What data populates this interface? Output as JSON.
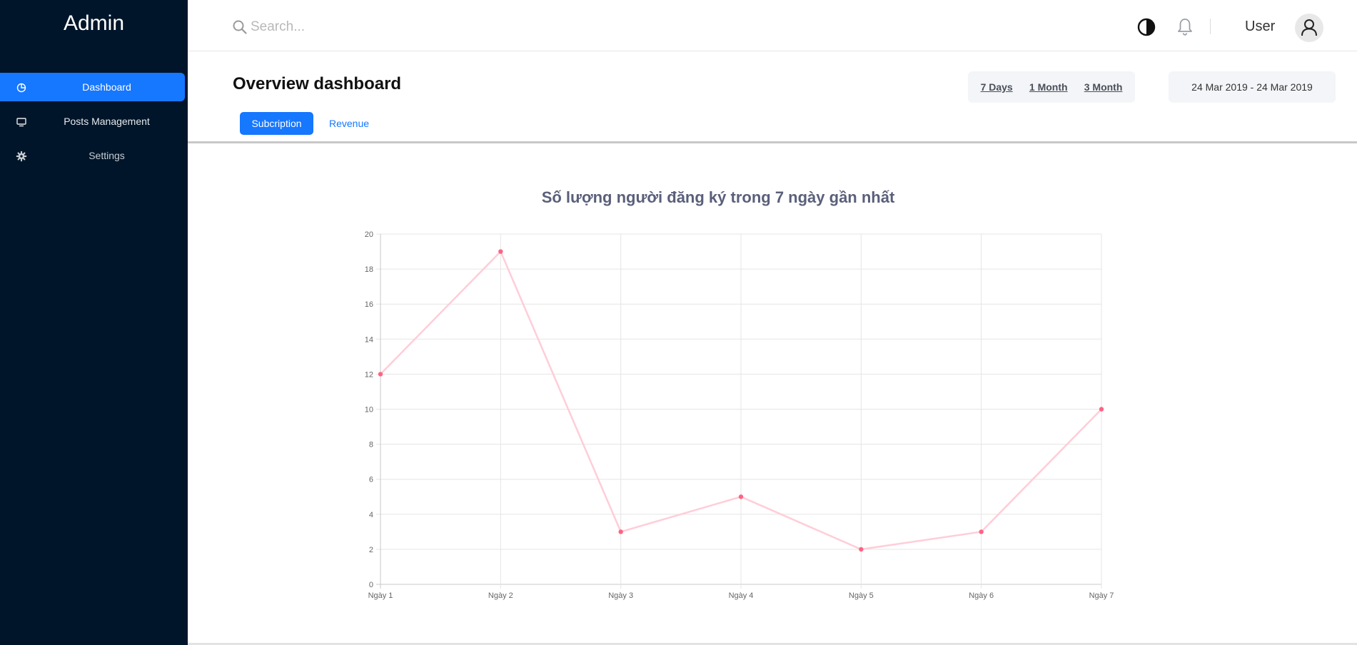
{
  "sidebar": {
    "brand": "Admin",
    "items": [
      {
        "label": "Dashboard",
        "icon": "pie-chart-icon",
        "active": true
      },
      {
        "label": "Posts Management",
        "icon": "monitor-icon",
        "active": false
      },
      {
        "label": "Settings",
        "icon": "gear-icon",
        "active": false
      }
    ]
  },
  "header": {
    "search_placeholder": "Search...",
    "user_name": "User",
    "icons": [
      "search-icon",
      "contrast-icon",
      "bell-icon",
      "user-avatar-icon"
    ]
  },
  "toolbar": {
    "title": "Overview dashboard",
    "ranges": [
      "7 Days",
      "1 Month",
      "3 Month"
    ],
    "date_range": "24 Mar 2019 - 24 Mar 2019",
    "tabs": [
      {
        "label": "Subcription",
        "active": true
      },
      {
        "label": "Revenue",
        "active": false
      }
    ]
  },
  "colors": {
    "sidebar_bg": "#001529",
    "accent": "#1677ff",
    "line": "#ffcdd8",
    "point": "#ff6384",
    "title": "#5a5f7a"
  },
  "chart_data": {
    "type": "line",
    "title": "Số lượng người đăng ký trong 7 ngày gần nhất",
    "categories": [
      "Ngày 1",
      "Ngày 2",
      "Ngày 3",
      "Ngày 4",
      "Ngày 5",
      "Ngày 6",
      "Ngày 7"
    ],
    "series": [
      {
        "values": [
          12,
          19,
          3,
          5,
          2,
          3,
          10
        ]
      }
    ],
    "ylim": [
      0,
      20
    ],
    "yticks": [
      "0",
      "2",
      "4",
      "6",
      "8",
      "10",
      "12",
      "14",
      "16",
      "18",
      "20"
    ],
    "grid": true,
    "legend": "none"
  }
}
